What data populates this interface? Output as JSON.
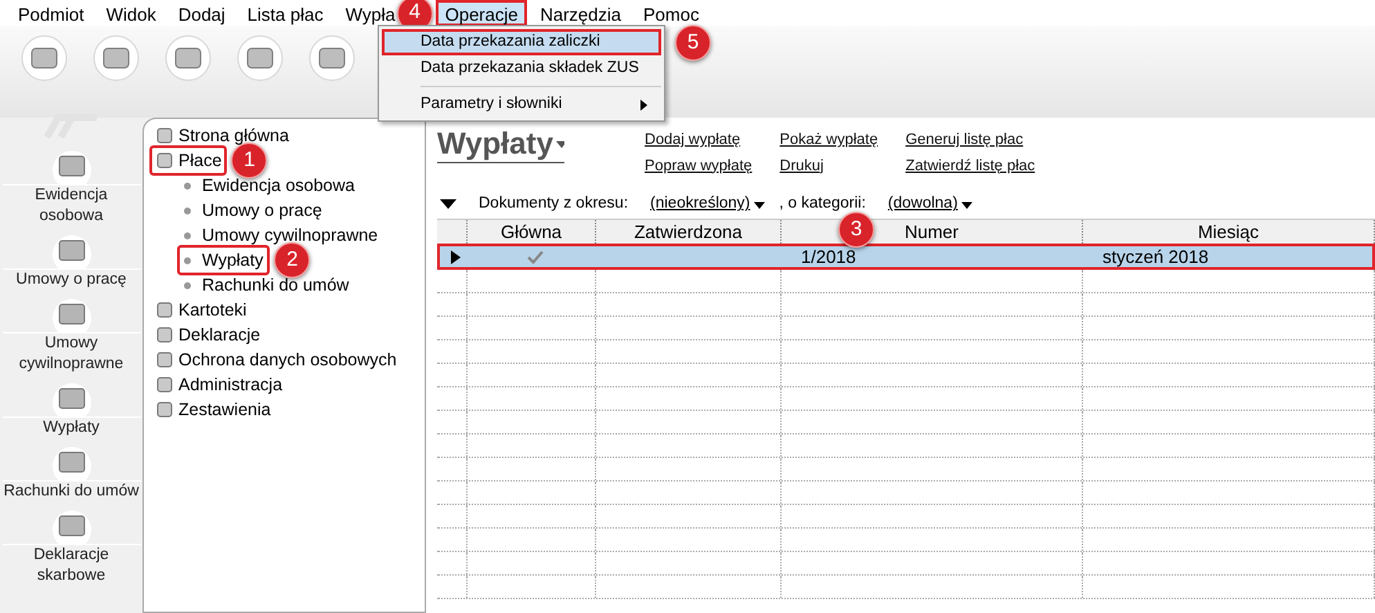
{
  "menu_bar": [
    {
      "label": "Podmiot",
      "selected": false
    },
    {
      "label": "Widok",
      "selected": false
    },
    {
      "label": "Dodaj",
      "selected": false
    },
    {
      "label": "Lista płac",
      "selected": false
    },
    {
      "label": "Wypła",
      "selected": false,
      "callout": "4"
    },
    {
      "label": "Operacje",
      "selected": true
    },
    {
      "label": "Narzędzia",
      "selected": false
    },
    {
      "label": "Pomoc",
      "selected": false
    }
  ],
  "dropdown": [
    {
      "label": "Data przekazania zaliczki",
      "selected": true,
      "submenu": false,
      "callout": "5"
    },
    {
      "label": "Data przekazania składek ZUS",
      "selected": false,
      "submenu": false
    },
    {
      "label": "Parametry i słowniki",
      "selected": false,
      "submenu": true
    }
  ],
  "left_bar": [
    {
      "label": "Ewidencja osobowa"
    },
    {
      "label": "Umowy o pracę"
    },
    {
      "label": "Umowy cywilnoprawne"
    },
    {
      "label": "Wypłaty"
    },
    {
      "label": "Rachunki do umów"
    },
    {
      "label": "Deklaracje skarbowe"
    }
  ],
  "tree": [
    {
      "label": "Strona główna",
      "selected": false
    },
    {
      "label": "Płace",
      "selected": true,
      "callout": "1",
      "children": [
        {
          "label": "Ewidencja osobowa",
          "selected": false
        },
        {
          "label": "Umowy o pracę",
          "selected": false
        },
        {
          "label": "Umowy cywilnoprawne",
          "selected": false
        },
        {
          "label": "Wypłaty",
          "selected": true,
          "callout": "2"
        },
        {
          "label": "Rachunki do umów",
          "selected": false
        }
      ]
    },
    {
      "label": "Kartoteki",
      "selected": false
    },
    {
      "label": "Deklaracje",
      "selected": false
    },
    {
      "label": "Ochrona danych osobowych",
      "selected": false
    },
    {
      "label": "Administracja",
      "selected": false
    },
    {
      "label": "Zestawienia",
      "selected": false
    }
  ],
  "page_title": "Wypłaty",
  "actions": [
    [
      "Dodaj wypłatę",
      "Popraw wypłatę"
    ],
    [
      "Pokaż wypłatę",
      "Drukuj"
    ],
    [
      "Generuj listę płac",
      "Zatwierdź listę płac"
    ]
  ],
  "filter": {
    "label": "Dokumenty z okresu:",
    "period": "(nieokreślony)",
    "separator": ", o kategorii:",
    "category": "(dowolna)"
  },
  "table": {
    "callout": "3",
    "columns": [
      "Główna",
      "Zatwierdzona",
      "Numer",
      "Miesiąc"
    ],
    "rows": [
      {
        "checked": true,
        "selected": true,
        "cells": [
          "",
          "",
          "1/2018",
          "styczeń 2018"
        ]
      }
    ]
  }
}
